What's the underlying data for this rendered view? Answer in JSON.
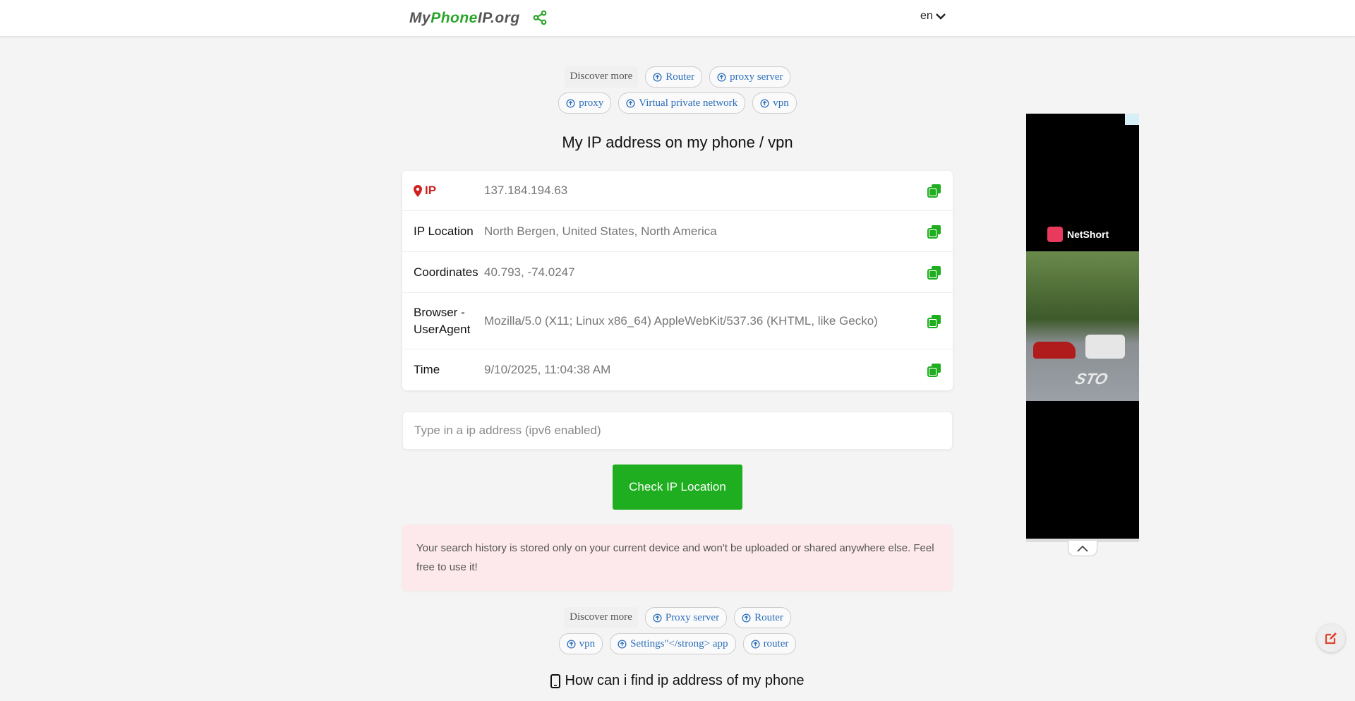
{
  "header": {
    "logo_prefix": "My",
    "logo_highlight": "Phone",
    "logo_suffix": "IP.org",
    "language": "en",
    "icons": {
      "share": "share-icon",
      "language_toggle": "chevron-down-icon"
    }
  },
  "discover_top": {
    "label": "Discover more",
    "row1": [
      "Router",
      "proxy server"
    ],
    "row2": [
      "proxy",
      "Virtual private network",
      "vpn"
    ]
  },
  "page_title": "My IP address on my phone / vpn",
  "info_card": {
    "rows": [
      {
        "label": "IP",
        "value": "137.184.194.63"
      },
      {
        "label": "IP Location",
        "value": "North Bergen, United States, North America"
      },
      {
        "label": "Coordinates",
        "value": "40.793, -74.0247"
      },
      {
        "label": "Browser - UserAgent",
        "value": "Mozilla/5.0 (X11; Linux x86_64) AppleWebKit/537.36 (KHTML, like Gecko)"
      },
      {
        "label": "Time",
        "value": "9/10/2025, 11:04:38 AM"
      }
    ]
  },
  "search": {
    "placeholder": "Type in a ip address (ipv6 enabled)",
    "value": ""
  },
  "check_button": "Check IP Location",
  "notice": "Your search history is stored only on your current device and won't be uploaded or shared anywhere else. Feel free to use it!",
  "discover_bottom": {
    "label": "Discover more",
    "row1": [
      "Proxy server",
      "Router"
    ],
    "row2": [
      "vpn",
      "Settings\"</strong> app",
      "router"
    ]
  },
  "howto_heading": "How can i find ip address of my phone",
  "ad": {
    "brand": "NetShort",
    "road_text": "STO"
  },
  "colors": {
    "brand_green": "#1fae1f",
    "ip_red": "#d02020",
    "link_blue": "#2a6ebb",
    "notice_bg": "#fde8eb"
  }
}
